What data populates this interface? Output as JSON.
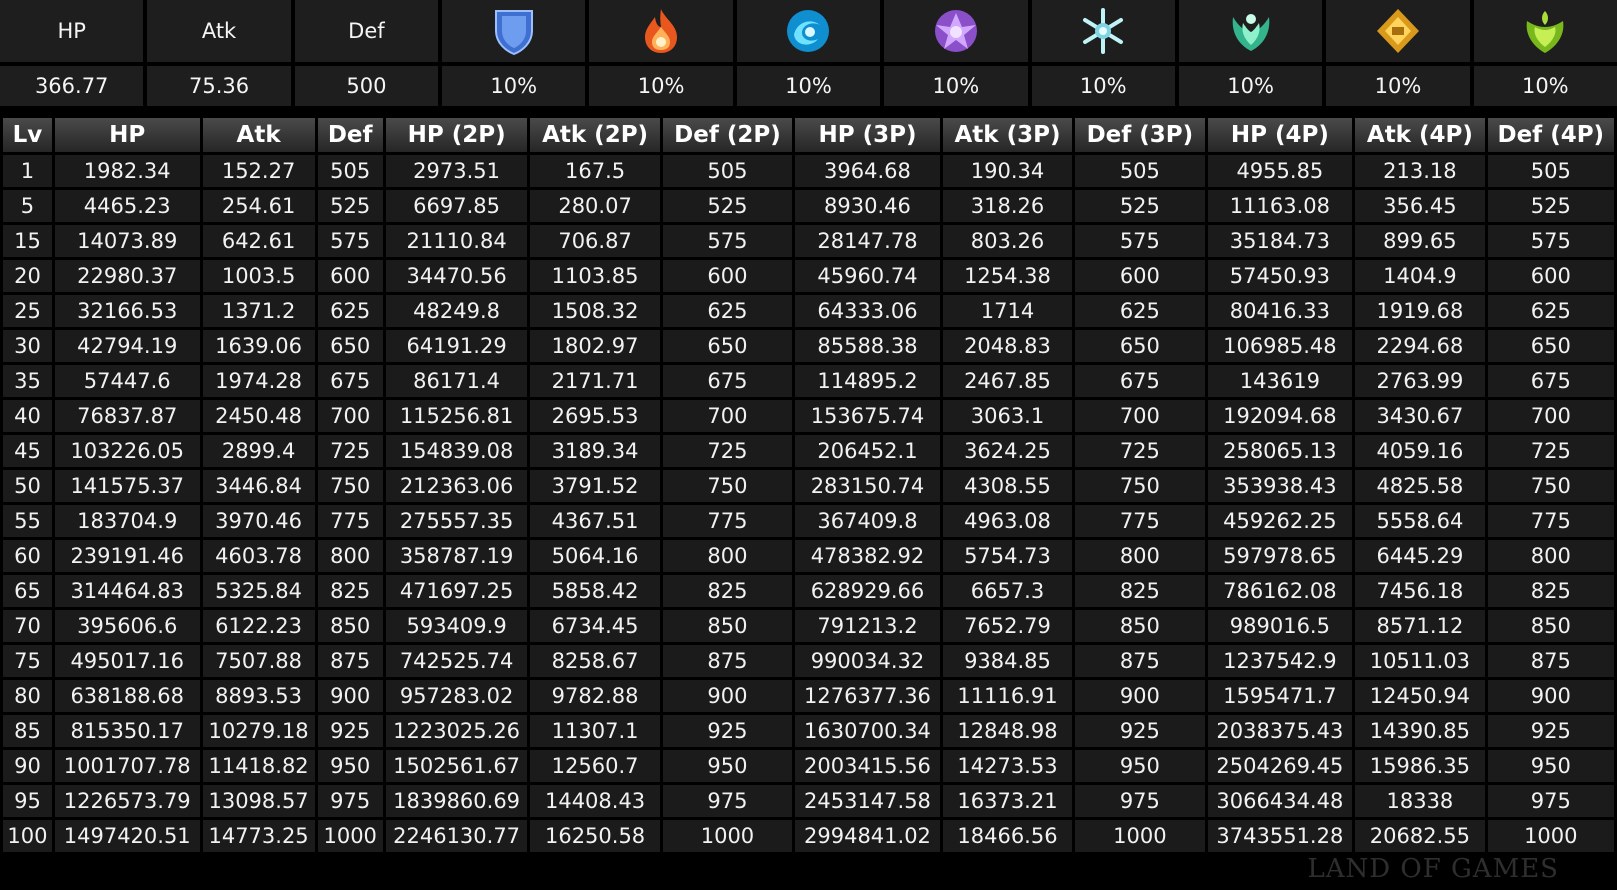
{
  "base_stats": {
    "columns": [
      {
        "label": "HP",
        "value": "366.77"
      },
      {
        "label": "Atk",
        "value": "75.36"
      },
      {
        "label": "Def",
        "value": "500"
      },
      {
        "icon": "physical-shield-icon",
        "value": "10%"
      },
      {
        "icon": "pyro-element-icon",
        "value": "10%"
      },
      {
        "icon": "hydro-element-icon",
        "value": "10%"
      },
      {
        "icon": "electro-element-icon",
        "value": "10%"
      },
      {
        "icon": "cryo-element-icon",
        "value": "10%"
      },
      {
        "icon": "anemo-element-icon",
        "value": "10%"
      },
      {
        "icon": "geo-element-icon",
        "value": "10%"
      },
      {
        "icon": "dendro-element-icon",
        "value": "10%"
      }
    ]
  },
  "colors": {
    "physical": "#5b8fe6",
    "pyro": "#f07a2a",
    "hydro": "#1fb3e8",
    "electro": "#b07be0",
    "cryo": "#9fe2ea",
    "anemo": "#4ec9a0",
    "geo": "#e8b22c",
    "dendro": "#8fcf2a"
  },
  "level_table": {
    "headers": [
      "Lv",
      "HP",
      "Atk",
      "Def",
      "HP (2P)",
      "Atk (2P)",
      "Def (2P)",
      "HP (3P)",
      "Atk (3P)",
      "Def (3P)",
      "HP (4P)",
      "Atk (4P)",
      "Def (4P)"
    ],
    "rows": [
      [
        "1",
        "1982.34",
        "152.27",
        "505",
        "2973.51",
        "167.5",
        "505",
        "3964.68",
        "190.34",
        "505",
        "4955.85",
        "213.18",
        "505"
      ],
      [
        "5",
        "4465.23",
        "254.61",
        "525",
        "6697.85",
        "280.07",
        "525",
        "8930.46",
        "318.26",
        "525",
        "11163.08",
        "356.45",
        "525"
      ],
      [
        "15",
        "14073.89",
        "642.61",
        "575",
        "21110.84",
        "706.87",
        "575",
        "28147.78",
        "803.26",
        "575",
        "35184.73",
        "899.65",
        "575"
      ],
      [
        "20",
        "22980.37",
        "1003.5",
        "600",
        "34470.56",
        "1103.85",
        "600",
        "45960.74",
        "1254.38",
        "600",
        "57450.93",
        "1404.9",
        "600"
      ],
      [
        "25",
        "32166.53",
        "1371.2",
        "625",
        "48249.8",
        "1508.32",
        "625",
        "64333.06",
        "1714",
        "625",
        "80416.33",
        "1919.68",
        "625"
      ],
      [
        "30",
        "42794.19",
        "1639.06",
        "650",
        "64191.29",
        "1802.97",
        "650",
        "85588.38",
        "2048.83",
        "650",
        "106985.48",
        "2294.68",
        "650"
      ],
      [
        "35",
        "57447.6",
        "1974.28",
        "675",
        "86171.4",
        "2171.71",
        "675",
        "114895.2",
        "2467.85",
        "675",
        "143619",
        "2763.99",
        "675"
      ],
      [
        "40",
        "76837.87",
        "2450.48",
        "700",
        "115256.81",
        "2695.53",
        "700",
        "153675.74",
        "3063.1",
        "700",
        "192094.68",
        "3430.67",
        "700"
      ],
      [
        "45",
        "103226.05",
        "2899.4",
        "725",
        "154839.08",
        "3189.34",
        "725",
        "206452.1",
        "3624.25",
        "725",
        "258065.13",
        "4059.16",
        "725"
      ],
      [
        "50",
        "141575.37",
        "3446.84",
        "750",
        "212363.06",
        "3791.52",
        "750",
        "283150.74",
        "4308.55",
        "750",
        "353938.43",
        "4825.58",
        "750"
      ],
      [
        "55",
        "183704.9",
        "3970.46",
        "775",
        "275557.35",
        "4367.51",
        "775",
        "367409.8",
        "4963.08",
        "775",
        "459262.25",
        "5558.64",
        "775"
      ],
      [
        "60",
        "239191.46",
        "4603.78",
        "800",
        "358787.19",
        "5064.16",
        "800",
        "478382.92",
        "5754.73",
        "800",
        "597978.65",
        "6445.29",
        "800"
      ],
      [
        "65",
        "314464.83",
        "5325.84",
        "825",
        "471697.25",
        "5858.42",
        "825",
        "628929.66",
        "6657.3",
        "825",
        "786162.08",
        "7456.18",
        "825"
      ],
      [
        "70",
        "395606.6",
        "6122.23",
        "850",
        "593409.9",
        "6734.45",
        "850",
        "791213.2",
        "7652.79",
        "850",
        "989016.5",
        "8571.12",
        "850"
      ],
      [
        "75",
        "495017.16",
        "7507.88",
        "875",
        "742525.74",
        "8258.67",
        "875",
        "990034.32",
        "9384.85",
        "875",
        "1237542.9",
        "10511.03",
        "875"
      ],
      [
        "80",
        "638188.68",
        "8893.53",
        "900",
        "957283.02",
        "9782.88",
        "900",
        "1276377.36",
        "11116.91",
        "900",
        "1595471.7",
        "12450.94",
        "900"
      ],
      [
        "85",
        "815350.17",
        "10279.18",
        "925",
        "1223025.26",
        "11307.1",
        "925",
        "1630700.34",
        "12848.98",
        "925",
        "2038375.43",
        "14390.85",
        "925"
      ],
      [
        "90",
        "1001707.78",
        "11418.82",
        "950",
        "1502561.67",
        "12560.7",
        "950",
        "2003415.56",
        "14273.53",
        "950",
        "2504269.45",
        "15986.35",
        "950"
      ],
      [
        "95",
        "1226573.79",
        "13098.57",
        "975",
        "1839860.69",
        "14408.43",
        "975",
        "2453147.58",
        "16373.21",
        "975",
        "3066434.48",
        "18338",
        "975"
      ],
      [
        "100",
        "1497420.51",
        "14773.25",
        "1000",
        "2246130.77",
        "16250.58",
        "1000",
        "2994841.02",
        "18466.56",
        "1000",
        "3743551.28",
        "20682.55",
        "1000"
      ]
    ]
  },
  "watermark": "LAND OF GAMES"
}
